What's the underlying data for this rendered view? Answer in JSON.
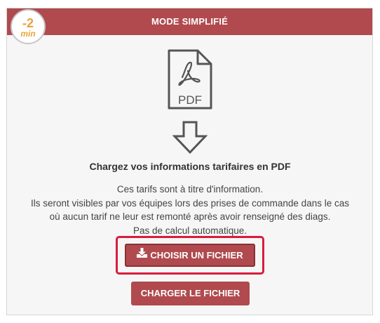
{
  "header": {
    "title": "MODE SIMPLIFIÉ"
  },
  "badge": {
    "value": "-2",
    "unit": "min"
  },
  "pdf_icon": {
    "label": "PDF"
  },
  "content": {
    "heading": "Chargez vos informations tarifaires en PDF",
    "lines": [
      "Ces tarifs sont à titre d'information.",
      "Ils seront visibles par vos équipes lors des prises de commande dans le cas",
      "où aucun tarif ne leur est remonté après avoir renseigné des diags.",
      "Pas de calcul automatique."
    ]
  },
  "buttons": {
    "choose_label": "CHOISIR UN FICHIER",
    "upload_label": "CHARGER LE FICHIER"
  },
  "colors": {
    "accent": "#b04a4e",
    "badge_text": "#e8a33a",
    "highlight": "#d91c3c",
    "panel_bg": "#f6f6f6"
  },
  "icons": [
    "pdf-file-icon",
    "down-arrow-icon",
    "download-icon"
  ]
}
